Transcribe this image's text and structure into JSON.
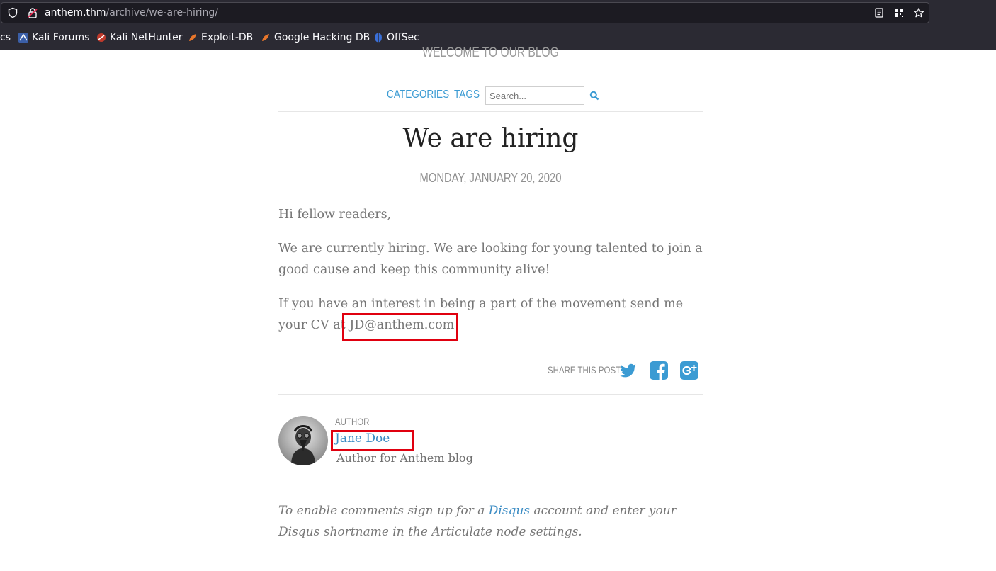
{
  "browser": {
    "url_host": "anthem.thm",
    "url_path": "/archive/we-are-hiring/",
    "bookmarks": [
      {
        "label": "cs",
        "icon": "none"
      },
      {
        "label": "Kali Forums",
        "icon": "kali-icon"
      },
      {
        "label": "Kali NetHunter",
        "icon": "nethunter-icon"
      },
      {
        "label": "Exploit-DB",
        "icon": "exploitdb-icon"
      },
      {
        "label": "Google Hacking DB",
        "icon": "ghdb-icon"
      },
      {
        "label": "OffSec",
        "icon": "offsec-icon"
      }
    ]
  },
  "site": {
    "tagline": "WELCOME TO OUR BLOG",
    "nav": {
      "categories": "CATEGORIES",
      "tags": "TAGS",
      "search_placeholder": "Search..."
    }
  },
  "post": {
    "title": "We are hiring",
    "date": "MONDAY, JANUARY 20, 2020",
    "para1": "Hi fellow readers,",
    "para2": "We are currently hiring. We are looking for young talented to join a good cause and keep this community alive!",
    "para3_prefix": "If you have an interest in being a part of the movement send me your CV at ",
    "email": "JD@anthem.com"
  },
  "share": {
    "label": "SHARE THIS POST",
    "icons": [
      "twitter-icon",
      "facebook-icon",
      "google-plus-icon"
    ]
  },
  "author": {
    "label": "AUTHOR",
    "name": "Jane Doe",
    "description": "Author for Anthem blog"
  },
  "comments": {
    "prefix": "To enable comments sign up for a ",
    "link": "Disqus",
    "suffix": " account and enter your Disqus shortname in the Articulate node settings."
  },
  "colors": {
    "link": "#3b9bd3",
    "highlight": "#e0000f",
    "chrome": "#2b2a33"
  }
}
